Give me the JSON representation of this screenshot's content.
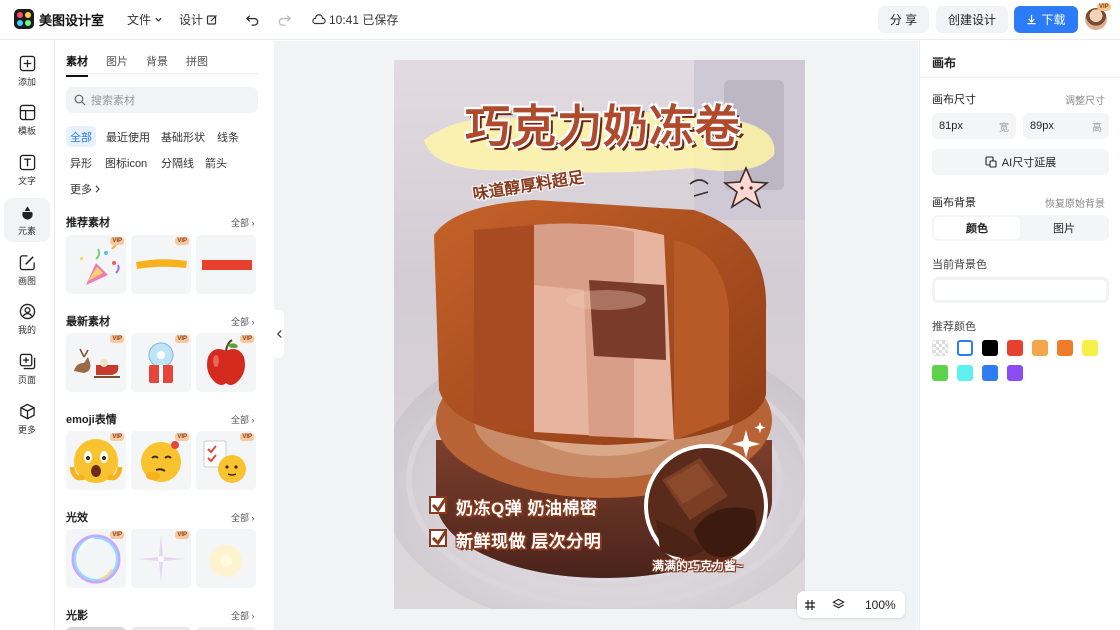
{
  "app": {
    "name": "美图设计室",
    "menu_file": "文件",
    "menu_design": "设计",
    "save_status": "10:41 已保存",
    "share_label": "分 享",
    "create_label": "创建设计",
    "download_label": "下载",
    "avatar_vip": "VIP"
  },
  "rail": [
    {
      "label": "添加",
      "icon": "plus-square-icon"
    },
    {
      "label": "模板",
      "icon": "template-icon"
    },
    {
      "label": "文字",
      "icon": "text-icon"
    },
    {
      "label": "元素",
      "icon": "shapes-icon"
    },
    {
      "label": "画图",
      "icon": "draw-icon"
    },
    {
      "label": "我的",
      "icon": "user-icon"
    },
    {
      "label": "页面",
      "icon": "page-add-icon"
    },
    {
      "label": "更多",
      "icon": "cube-icon"
    }
  ],
  "panel": {
    "tabs": [
      "素材",
      "图片",
      "背景",
      "拼图"
    ],
    "search_placeholder": "搜索素材",
    "chips": [
      "全部",
      "最近使用",
      "基础形状",
      "线条",
      "异形",
      "图标icon",
      "分隔线",
      "箭头",
      "更多"
    ],
    "all_label": "全部",
    "vip": "VIP",
    "sections": [
      {
        "title": "推荐素材",
        "tiles": [
          "party-popper",
          "yellow-brush-stroke",
          "red-bar"
        ]
      },
      {
        "title": "最新素材",
        "tiles": [
          "reindeer-sleigh",
          "snow-globe-gift",
          "red-apple"
        ]
      },
      {
        "title": "emoji表情",
        "tiles": [
          "shocked-face",
          "thinking-face",
          "checklist-face"
        ]
      },
      {
        "title": "光效",
        "tiles": [
          "soap-bubble",
          "star-sparkle",
          "glow-light"
        ]
      },
      {
        "title": "光影",
        "tiles": []
      }
    ]
  },
  "poster": {
    "title": "巧克力奶冻卷",
    "subtitle": "味道醇厚料超足",
    "bullet1": "奶冻Q弹 奶油棉密",
    "bullet2": "新鲜现做 层次分明",
    "circle_caption": "满满的巧克力酱~"
  },
  "zoom": {
    "value": "100%"
  },
  "right": {
    "title": "画布",
    "size_label": "画布尺寸",
    "adjust_size": "调整尺寸",
    "width_value": "81px",
    "width_unit": "宽",
    "height_value": "89px",
    "height_unit": "高",
    "ai_extend": "AI尺寸延展",
    "bg_label": "画布背景",
    "restore_bg": "恢复原始背景",
    "bg_tab_color": "颜色",
    "bg_tab_image": "图片",
    "current_bg": "当前背景色",
    "recommend": "推荐颜色",
    "swatches": [
      "transparent",
      "#ffffff",
      "#000000",
      "#e8402f",
      "#f4a64a",
      "#f07c2a",
      "#f7f04a",
      "#5bd24a",
      "#5ff0f0",
      "#2f7df0",
      "#8a4ef0"
    ]
  }
}
